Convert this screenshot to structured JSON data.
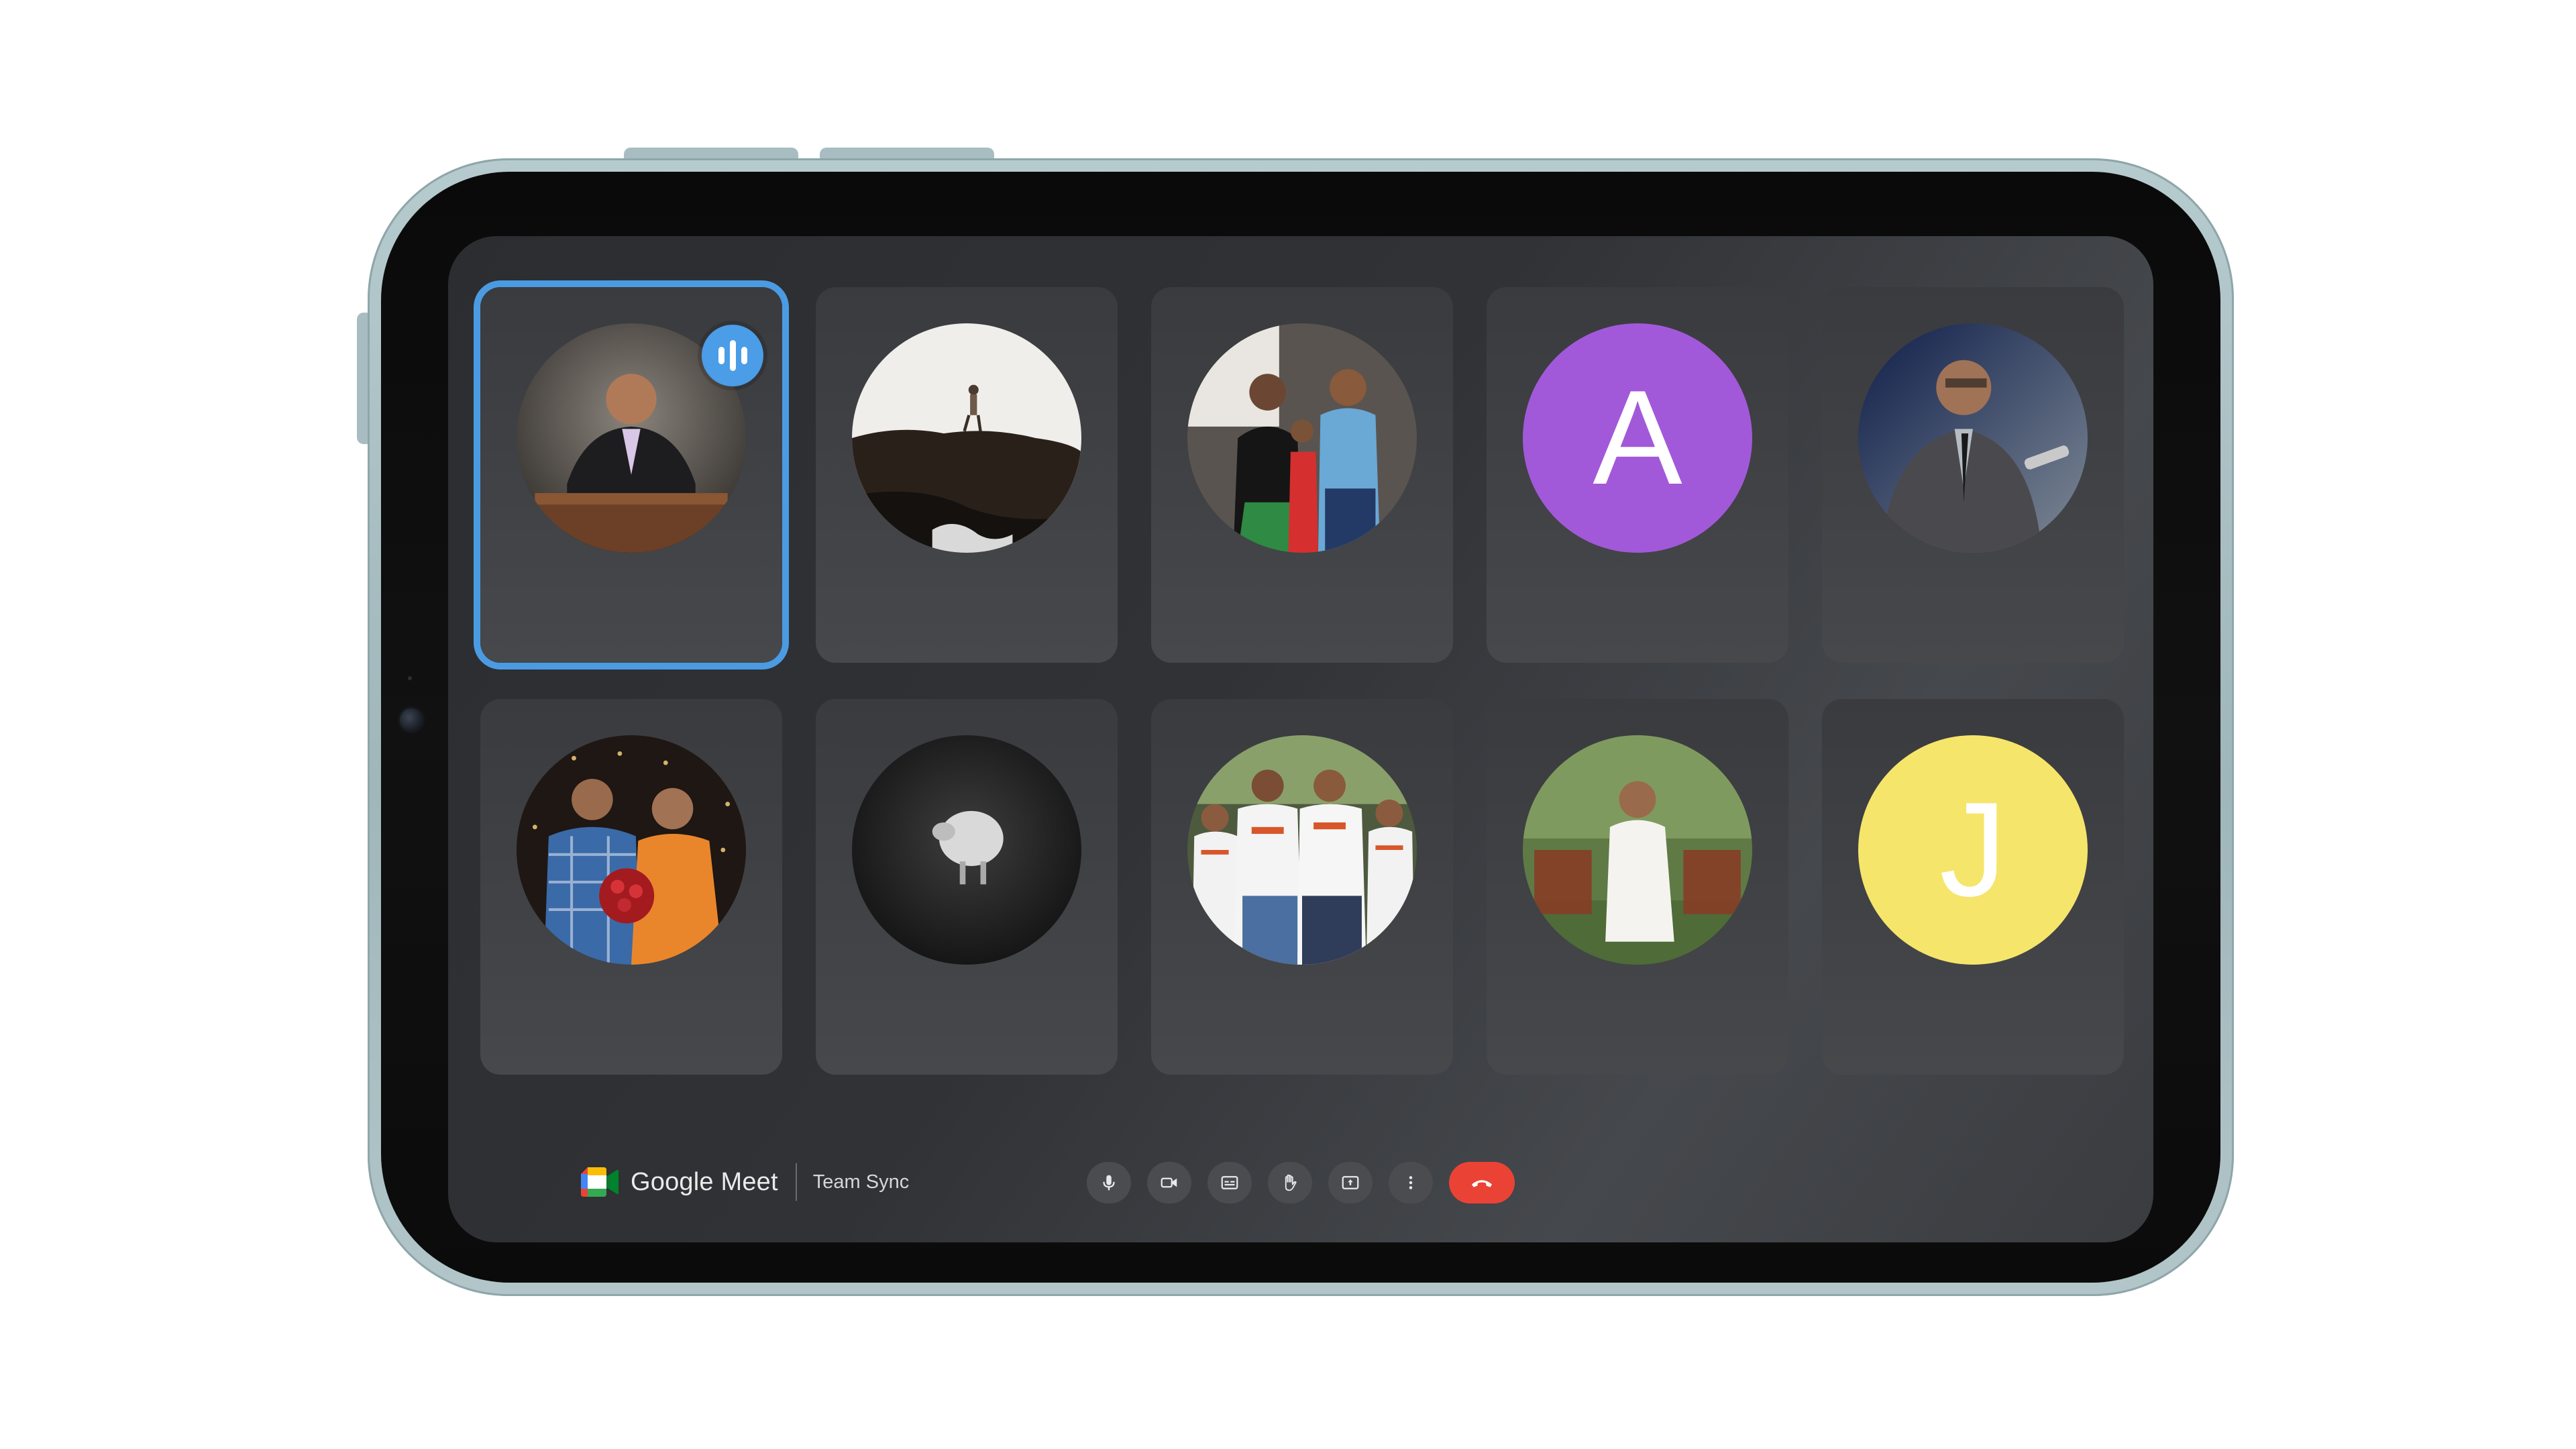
{
  "app": {
    "brand_name": "Google Meet",
    "meeting_name": "Team Sync"
  },
  "participants": [
    {
      "kind": "photo",
      "photo": "man in suit speaking at podium",
      "speaking": true
    },
    {
      "kind": "photo",
      "photo": "person standing on rocky cliff"
    },
    {
      "kind": "photo",
      "photo": "family portrait indoors"
    },
    {
      "kind": "letter",
      "initial": "A",
      "color": "#a259d9",
      "text_color": "#ffffff"
    },
    {
      "kind": "photo",
      "photo": "man with glasses at microphone"
    },
    {
      "kind": "photo",
      "photo": "couple with flower bouquet"
    },
    {
      "kind": "photo",
      "photo": "sheep in the dark"
    },
    {
      "kind": "photo",
      "photo": "family in matching t-shirts"
    },
    {
      "kind": "photo",
      "photo": "woman in white dress in garden"
    },
    {
      "kind": "letter",
      "initial": "J",
      "color": "#f6e56b",
      "text_color": "#ffffff"
    }
  ],
  "controls": [
    {
      "name": "microphone",
      "icon": "mic-icon"
    },
    {
      "name": "camera",
      "icon": "video-camera-icon"
    },
    {
      "name": "captions",
      "icon": "captions-icon"
    },
    {
      "name": "raise-hand",
      "icon": "hand-icon"
    },
    {
      "name": "present",
      "icon": "present-screen-icon"
    },
    {
      "name": "more-options",
      "icon": "more-vertical-icon"
    },
    {
      "name": "end-call",
      "icon": "end-call-icon"
    }
  ],
  "colors": {
    "active_speaker_border": "#4b9be3",
    "end_call": "#ea4335",
    "control_bg": "#4a4c50",
    "tile_bg": "#3a3b3f",
    "tablet_frame": "#a7bdc1"
  }
}
